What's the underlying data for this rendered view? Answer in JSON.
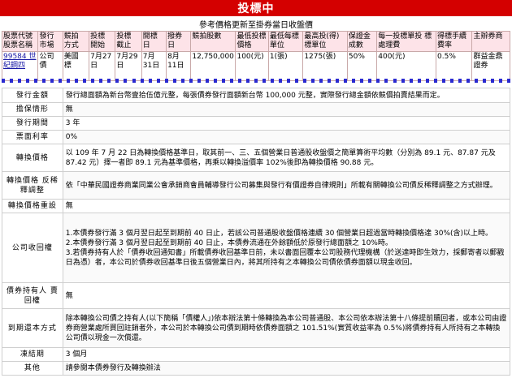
{
  "banner": {
    "title": "投標中"
  },
  "subtitle": "參考價格更新至掛券當日收盤價",
  "summary": {
    "headers": [
      "股票代號 股票名稱",
      "發行 市場",
      "競拍 方式",
      "投標 開始",
      "投標 截止",
      "開標 日",
      "撥券 日",
      "競拍股數",
      "最低投標 價格",
      "最低每標 單位",
      "最高投(得) 標單位",
      "保證金 成數",
      "每一投標單投 標處理費",
      "得標手續 費率",
      "主辦券商"
    ],
    "row": [
      "99584 世紀鋼四",
      "公司 債",
      "美國 標",
      "7月27 日",
      "7月29 日",
      "7月 31日",
      "8月 11日",
      "12,750,000",
      "100(元)",
      "1(張)",
      "1275(張)",
      "50%",
      "400(元)",
      "0.5%",
      "群益金鼎 證券"
    ]
  },
  "details": [
    {
      "label": "發行金額",
      "value": "發行總面額為新台幣壹拾伍億元整，每張債券發行面額新台幣 100,000 元整，實際發行總金額依競價拍賣結果而定。"
    },
    {
      "label": "擔保情形",
      "value": "無"
    },
    {
      "label": "發行期間",
      "value": "3 年"
    },
    {
      "label": "票面利率",
      "value": "0%"
    },
    {
      "label": "轉換價格",
      "value": "以 109 年 7 月 22 日為轉換價格基準日，取其前一、三、五個營業日普通股收盤價之簡單算術平均數（分別為 89.1 元、87.87 元及 87.42 元）擇一者即 89.1 元為基準價格，再乘以轉換溢價率 102%後即為轉換價格 90.88 元。"
    },
    {
      "label": "轉換價格 反稀釋調整",
      "value": "依「中華民國證券商業同業公會承銷商會員輔導發行公司募集與發行有價證券自律規則」所載有關轉換公司債反稀釋調整之方式辦理。"
    },
    {
      "label": "轉換價格重設",
      "value": "無"
    },
    {
      "label": "公司收回權",
      "items": [
        "1.本債券發行滿 3 個月翌日起至到期前 40 日止，若該公司普通股收盤價格連續 30 個營業日超過當時轉換價格達 30%(含)以上時。",
        "2.本債券發行滿 3 個月翌日起至到期前 40 日止，本債券流通在外餘額低於原發行總面額之 10%時。",
        "3.若債券持有人於「債券收回通知書」所載債券收回基準日前，未以書面回覆本公司股務代理機構（於送達時即生效力，採郵寄者以郵戳日為憑）者，本公司於債券收回基準日後五個營業日內，將其所持有之本轉換公司債依債券面額以現金收回。"
      ]
    },
    {
      "label": "債券持有人 賣回權",
      "value": "無"
    },
    {
      "label": "到期還本方式",
      "value": "除本轉換公司債之持有人(以下簡稱「債權人」)依本辦法第十條轉換為本公司普通股、本公司依本辦法第十八條提前贖回者，或本公司由證券商營業處所買回註銷者外，本公司於本轉換公司債到期時依債券面額之 101.51%(實質收益率為 0.5%)將債券持有人所持有之本轉換公司債以現金一次償還。"
    },
    {
      "label": "凍結期",
      "value": "3 個月"
    },
    {
      "label": "其他",
      "value": "請參閱本債券發行及轉換辦法"
    }
  ]
}
